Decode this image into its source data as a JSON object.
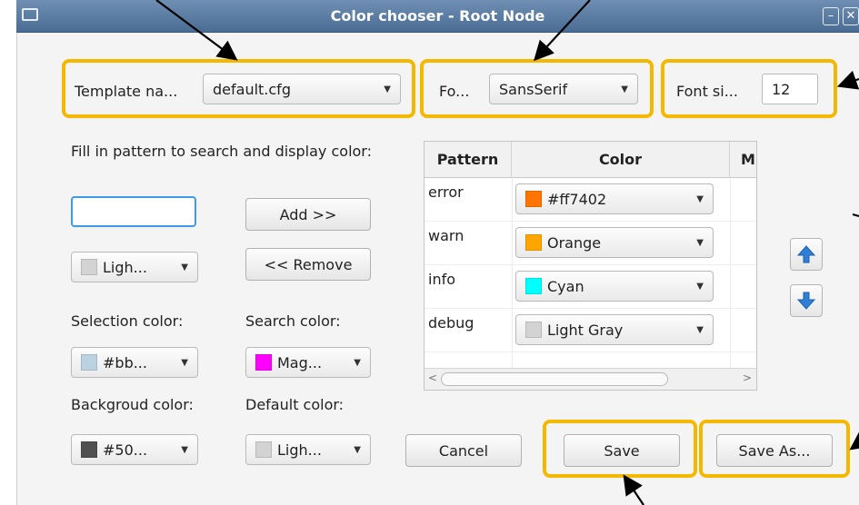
{
  "window": {
    "title": "Color chooser - Root Node",
    "minimize_label": "–",
    "close_label": "✕"
  },
  "template": {
    "label": "Template na...",
    "value": "default.cfg"
  },
  "font": {
    "label": "Fo...",
    "value": "SansSerif"
  },
  "font_size": {
    "label": "Font si...",
    "value": "12"
  },
  "instructions": "Fill in pattern to search and display color:",
  "pattern_input": {
    "value": "",
    "placeholder": ""
  },
  "add_button": "Add >>",
  "remove_button": "<< Remove",
  "pattern_color_combo": {
    "value": "Ligh...",
    "color": "#d3d3d3"
  },
  "selection_color": {
    "label": "Selection color:",
    "value": "#bb...",
    "color": "#bbd2e1"
  },
  "search_color": {
    "label": "Search color:",
    "value": "Mag...",
    "color": "#ff00ff"
  },
  "background_color": {
    "label": "Backgroud color:",
    "value": "#50...",
    "color": "#505050"
  },
  "default_color": {
    "label": "Default color:",
    "value": "Ligh...",
    "color": "#d3d3d3"
  },
  "table": {
    "headers": [
      "Pattern",
      "Color",
      "M"
    ],
    "rows": [
      {
        "pattern": "error",
        "color_name": "#ff7402",
        "color": "#ff7402"
      },
      {
        "pattern": "warn",
        "color_name": "Orange",
        "color": "#ffa500"
      },
      {
        "pattern": "info",
        "color_name": "Cyan",
        "color": "#00ffff"
      },
      {
        "pattern": "debug",
        "color_name": "Light Gray",
        "color": "#d3d3d3"
      }
    ]
  },
  "move_up_icon": "arrow-up-icon",
  "move_down_icon": "arrow-down-icon",
  "cancel_button": "Cancel",
  "save_button": "Save",
  "save_as_button": "Save As...",
  "highlight_color": "#f5b800",
  "accent_color": "#2f7fd6"
}
